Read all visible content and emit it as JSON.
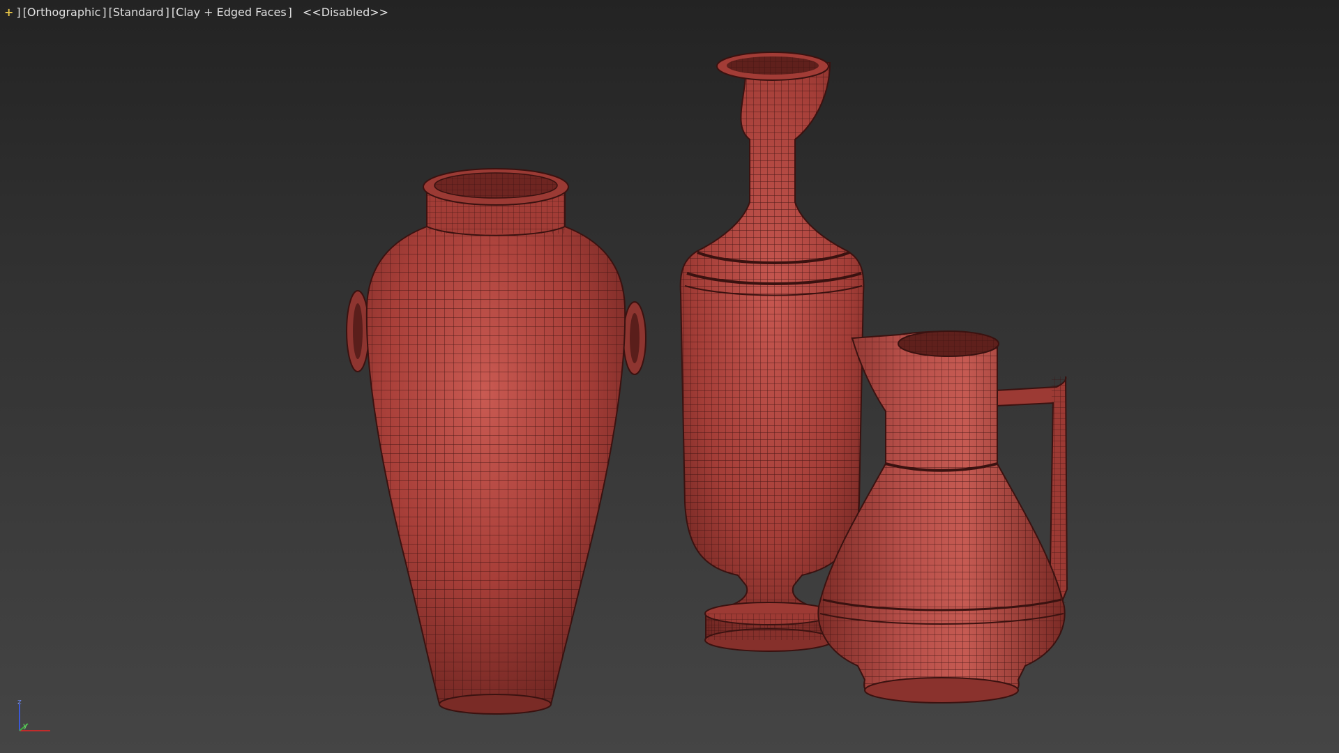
{
  "viewport": {
    "plus_label": "+",
    "view_label": "Orthographic",
    "shading_label": "Standard",
    "display_label": "Clay + Edged Faces",
    "status_label": "<<Disabled>>"
  },
  "axis_gizmo": {
    "z_label": "z",
    "y_label": "y",
    "x_color": "#c22b2b",
    "y_color": "#3fae3f",
    "z_color": "#3b58d6"
  },
  "scene": {
    "objects": [
      "amphora",
      "tall-vase",
      "pitcher"
    ],
    "clay_color": "#b4463f",
    "wire_color": "#3a1210"
  }
}
